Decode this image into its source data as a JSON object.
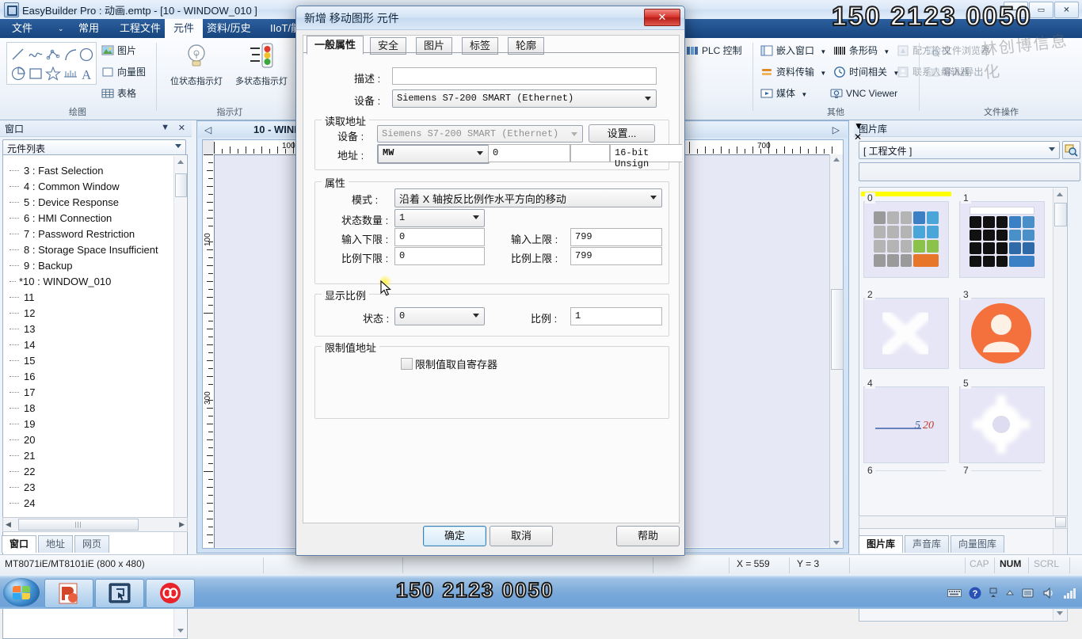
{
  "window": {
    "title": "EasyBuilder Pro : 动画.emtp - [10 - WINDOW_010 ]",
    "app_icon": "app-icon",
    "minimize": "—",
    "maximize": "▭",
    "close": "✕"
  },
  "ribbon": {
    "tabs": [
      {
        "label": "文件",
        "active": false
      },
      {
        "label": "⌄",
        "active": false
      },
      {
        "label": "常用",
        "active": false
      },
      {
        "label": "工程文件",
        "active": false
      },
      {
        "label": "元件",
        "active": true
      },
      {
        "label": "资料/历史",
        "active": false
      },
      {
        "label": "IIoT/能",
        "active": false
      }
    ],
    "groups": [
      {
        "name": "绘图"
      },
      {
        "name": "指示灯"
      },
      {
        "name": "其他"
      },
      {
        "name": "文件操作"
      }
    ],
    "draw_icons": [
      "line-icon",
      "polyline-icon",
      "polygon-icon",
      "arc-icon",
      "ellipse-icon",
      "pie-icon",
      "rectangle-icon",
      "star-icon",
      "scale-icon",
      "text-icon"
    ],
    "draw_buttons": [
      {
        "label": "图片",
        "icon": "picture-icon"
      },
      {
        "label": "向量图",
        "icon": "vector-graphic-icon"
      },
      {
        "label": "表格",
        "icon": "table-icon"
      }
    ],
    "lamp_buttons": [
      {
        "label": "位状态指示灯",
        "icon": "bit-lamp-icon"
      },
      {
        "label": "多状态指示灯",
        "icon": "multi-state-lamp-icon"
      }
    ],
    "other_buttons": [
      {
        "label": "PLC 控制",
        "icon": "plc-control-icon",
        "disabled": false
      },
      {
        "label": "嵌入窗口",
        "icon": "embedded-window-icon",
        "disabled": false,
        "dropdown": true
      },
      {
        "label": "条形码",
        "icon": "barcode-icon",
        "disabled": false,
        "dropdown": true
      },
      {
        "label": "配方检视",
        "icon": "recipe-view-icon",
        "disabled": true
      },
      {
        "label": "资料传输",
        "icon": "data-transfer-icon",
        "disabled": false,
        "dropdown": true
      },
      {
        "label": "时间相关",
        "icon": "time-related-icon",
        "disabled": false,
        "dropdown": true
      },
      {
        "label": "联系人编辑器",
        "icon": "contact-editor-icon",
        "disabled": true
      },
      {
        "label": "媒体",
        "icon": "media-icon",
        "disabled": false,
        "dropdown": true
      },
      {
        "label": "VNC Viewer",
        "icon": "vnc-viewer-icon",
        "disabled": false
      }
    ],
    "file_buttons": [
      {
        "label": "文件浏览器",
        "icon": "file-browser-icon",
        "disabled": true
      },
      {
        "label": "导入/导出",
        "icon": "import-export-icon",
        "disabled": true
      }
    ]
  },
  "left_panel": {
    "title": "窗口",
    "collapse_icon": "chevron-down-icon",
    "close_icon": "close-icon",
    "selector_value": "元件列表",
    "tree_items": [
      "3 : Fast Selection",
      "4 : Common Window",
      "5 : Device Response",
      "6 : HMI Connection",
      "7 : Password Restriction",
      "8 : Storage Space Insufficient",
      "9 : Backup",
      "*10 : WINDOW_010",
      "11",
      "12",
      "13",
      "14",
      "15",
      "16",
      "17",
      "18",
      "19",
      "20",
      "21",
      "22",
      "23",
      "24"
    ],
    "bottom_tabs": [
      {
        "label": "窗口",
        "selected": true
      },
      {
        "label": "地址",
        "selected": false
      },
      {
        "label": "网页",
        "selected": false
      }
    ]
  },
  "editor": {
    "tab_title": "10 - WINDOW",
    "nav_left_icon": "nav-left-icon",
    "nav_right_icon": "nav-right-icon",
    "ruler_h_label": "100",
    "ruler_h_label2": "700",
    "ruler_v_label": "100"
  },
  "right_panel": {
    "title": "图片库",
    "collapse_icon": "chevron-down-icon",
    "close_icon": "close-icon",
    "source_value": "[ 工程文件 ]",
    "search_icon": "search-icon",
    "name_field_value": "",
    "items": [
      {
        "index": "0",
        "kind": "keypad-gray",
        "selected": true
      },
      {
        "index": "1",
        "kind": "keypad-black",
        "selected": false
      },
      {
        "index": "2",
        "kind": "x-mark",
        "selected": false
      },
      {
        "index": "3",
        "kind": "user-avatar",
        "selected": false
      },
      {
        "index": "4",
        "kind": "label-520",
        "selected": false
      },
      {
        "index": "5",
        "kind": "gear",
        "selected": false
      },
      {
        "index": "6",
        "kind": "blank",
        "selected": false
      },
      {
        "index": "7",
        "kind": "blank",
        "selected": false
      }
    ],
    "bottom_tabs": [
      {
        "label": "图片库",
        "selected": true
      },
      {
        "label": "声音库",
        "selected": false
      },
      {
        "label": "向量图库",
        "selected": false
      }
    ]
  },
  "statusbar": {
    "model": "MT8071iE/MT8101iE (800 x 480)",
    "x": "X = 559",
    "y": "Y = 3",
    "cap": "CAP",
    "num": "NUM",
    "scrl": "SCRL"
  },
  "taskbar": {
    "start_icon": "windows-start-icon",
    "items": [
      {
        "icon": "powerpoint-icon"
      },
      {
        "icon": "easybuilder-icon"
      },
      {
        "icon": "recorder-icon"
      }
    ],
    "tray_icons": [
      "keyboard-icon",
      "help-icon",
      "show-desktop-icon",
      "show-hidden-icon",
      "network-icon",
      "volume-icon",
      "signal-icon"
    ]
  },
  "dialog": {
    "title": "新增 移动图形 元件",
    "close_label": "✕",
    "tabs": [
      {
        "label": "一般属性",
        "selected": true
      },
      {
        "label": "安全",
        "selected": false
      },
      {
        "label": "图片",
        "selected": false
      },
      {
        "label": "标签",
        "selected": false
      },
      {
        "label": "轮廓",
        "selected": false
      }
    ],
    "description_label": "描述 :",
    "description_value": "",
    "device_label": "设备 :",
    "device_value": "Siemens S7-200 SMART (Ethernet)",
    "read_address": {
      "group_label": "读取地址",
      "device_label": "设备 :",
      "device_value": "Siemens S7-200 SMART (Ethernet)",
      "settings_button": "设置...",
      "address_label": "地址 :",
      "address_type_value": "MW",
      "address_value": "0",
      "address_extra": "",
      "format_value": "16-bit Unsign"
    },
    "attributes": {
      "group_label": "属性",
      "mode_label": "模式 :",
      "mode_value": "沿着 X 轴按反比例作水平方向的移动",
      "state_count_label": "状态数量 :",
      "state_count_value": "1",
      "input_min_label": "输入下限 :",
      "input_min_value": "0",
      "input_max_label": "输入上限 :",
      "input_max_value": "799",
      "scale_min_label": "比例下限 :",
      "scale_min_value": "0",
      "scale_max_label": "比例上限 :",
      "scale_max_value": "799"
    },
    "display_ratio": {
      "group_label": "显示比例",
      "state_label": "状态 :",
      "state_value": "0",
      "ratio_label": "比例 :",
      "ratio_value": "1"
    },
    "limit_address": {
      "group_label": "限制值地址",
      "checkbox_label": "限制值取自寄存器",
      "checked": false
    },
    "buttons": {
      "ok": "确定",
      "cancel": "取消",
      "help": "帮助"
    }
  },
  "watermark": {
    "top": "150 2123 0050",
    "bottom": "150 2123 0050",
    "faint": "林创博信息化"
  }
}
